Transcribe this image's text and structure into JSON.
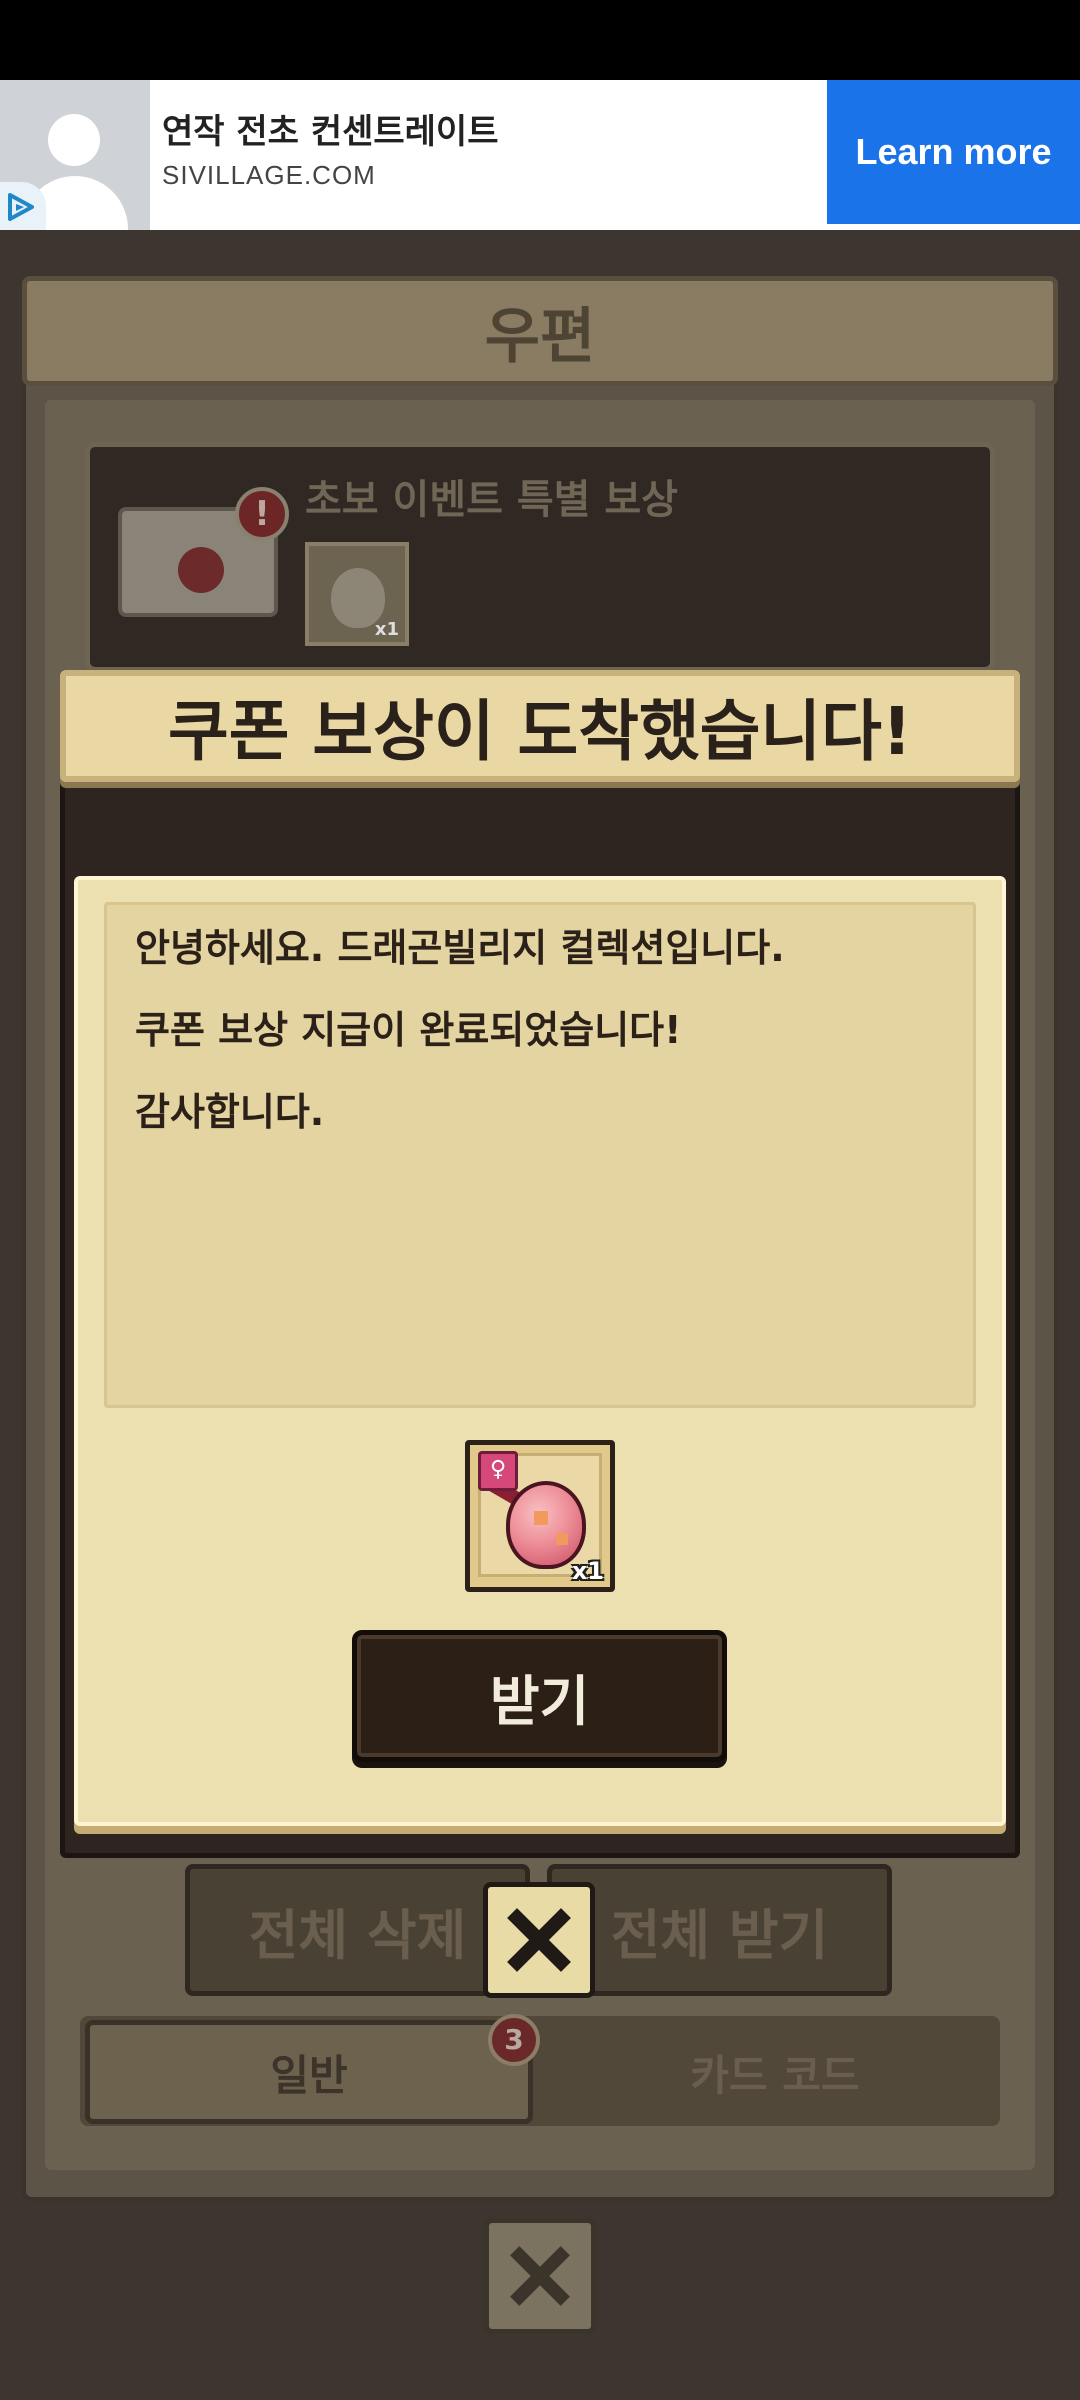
{
  "ad": {
    "title": "연작 전초 컨센트레이트",
    "domain": "SIVILLAGE.COM",
    "cta": "Learn more",
    "cta_color": "#1a73e8"
  },
  "mailbox": {
    "title": "우편",
    "item": {
      "title": "초보 이벤트 특별 보상",
      "alert": "!",
      "reward_qty": "x1"
    },
    "buttons": {
      "delete_all": "전체 삭제",
      "receive_all": "전체 받기"
    },
    "tabs": {
      "normal": "일반",
      "normal_badge": "3",
      "card_code": "카드 코드"
    }
  },
  "modal": {
    "banner": "쿠폰 보상이 도착했습니다!",
    "messages": [
      "안녕하세요. 드래곤빌리지 컬렉션입니다.",
      "쿠폰 보상 지급이 완료되었습니다!",
      "감사합니다."
    ],
    "reward": {
      "tag": "♀",
      "qty": "x1"
    },
    "receive_button": "받기"
  },
  "icons": {
    "close": "close-icon",
    "adchoices": "adchoices-icon",
    "avatar": "avatar-placeholder-icon",
    "envelope": "envelope-icon",
    "egg": "dragon-egg-icon"
  }
}
